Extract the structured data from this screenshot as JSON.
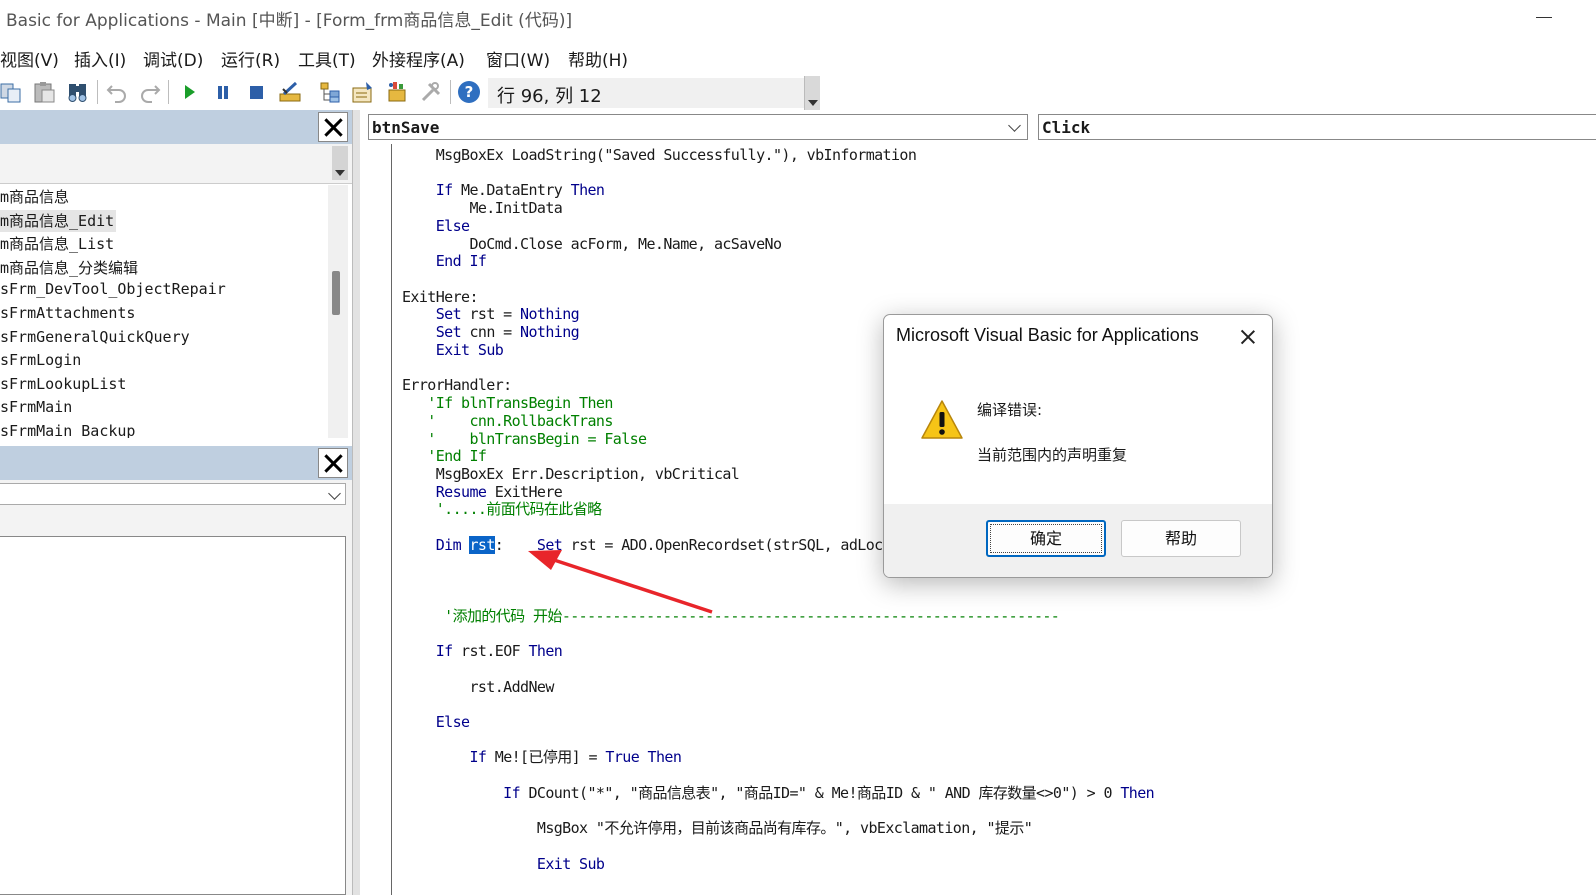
{
  "window": {
    "title": "Basic for Applications - Main [中断] - [Form_frm商品信息_Edit (代码)]"
  },
  "menu": {
    "items": [
      "视图(V)",
      "插入(I)",
      "调试(D)",
      "运行(R)",
      "工具(T)",
      "外接程序(A)",
      "窗口(W)",
      "帮助(H)"
    ]
  },
  "toolbar": {
    "icons": [
      "copy-icon",
      "paste-icon",
      "find-icon",
      "undo-icon",
      "redo-icon",
      "run-icon",
      "break-icon",
      "reset-icon",
      "design-mode-icon",
      "project-explorer-icon",
      "properties-icon",
      "object-browser-icon",
      "toolbox-icon",
      "help-icon"
    ],
    "cursor_position": "行 96, 列 12"
  },
  "project_explorer": {
    "items": [
      "m商品信息",
      "m商品信息_Edit",
      "m商品信息_List",
      "m商品信息_分类编辑",
      "sFrm_DevTool_ObjectRepair",
      "sFrmAttachments",
      "sFrmGeneralQuickQuery",
      "sFrmLogin",
      "sFrmLookupList",
      "sFrmMain",
      "sFrmMain_Backup"
    ],
    "selected_index": 1
  },
  "code_window": {
    "object": "btnSave",
    "procedure": "Click"
  },
  "code_lines": [
    [
      {
        "t": "    MsgBoxEx LoadString(\"Saved Successfully.\"), vbInformation",
        "c": ""
      }
    ],
    [
      {
        "t": "",
        "c": ""
      }
    ],
    [
      {
        "t": "    ",
        "c": ""
      },
      {
        "t": "If",
        "c": "kw"
      },
      {
        "t": " Me.DataEntry ",
        "c": ""
      },
      {
        "t": "Then",
        "c": "kw"
      }
    ],
    [
      {
        "t": "        Me.InitData",
        "c": ""
      }
    ],
    [
      {
        "t": "    ",
        "c": ""
      },
      {
        "t": "Else",
        "c": "kw"
      }
    ],
    [
      {
        "t": "        DoCmd.Close acForm, Me.Name, acSaveNo",
        "c": ""
      }
    ],
    [
      {
        "t": "    ",
        "c": ""
      },
      {
        "t": "End If",
        "c": "kw"
      }
    ],
    [
      {
        "t": "",
        "c": ""
      }
    ],
    [
      {
        "t": "ExitHere:",
        "c": ""
      }
    ],
    [
      {
        "t": "    ",
        "c": ""
      },
      {
        "t": "Set",
        "c": "kw"
      },
      {
        "t": " rst = ",
        "c": ""
      },
      {
        "t": "Nothing",
        "c": "kw"
      }
    ],
    [
      {
        "t": "    ",
        "c": ""
      },
      {
        "t": "Set",
        "c": "kw"
      },
      {
        "t": " cnn = ",
        "c": ""
      },
      {
        "t": "Nothing",
        "c": "kw"
      }
    ],
    [
      {
        "t": "    ",
        "c": ""
      },
      {
        "t": "Exit Sub",
        "c": "kw"
      }
    ],
    [
      {
        "t": "",
        "c": ""
      }
    ],
    [
      {
        "t": "ErrorHandler:",
        "c": ""
      }
    ],
    [
      {
        "t": "   'If blnTransBegin Then",
        "c": "cm"
      }
    ],
    [
      {
        "t": "   '    cnn.RollbackTrans",
        "c": "cm"
      }
    ],
    [
      {
        "t": "   '    blnTransBegin = False",
        "c": "cm"
      }
    ],
    [
      {
        "t": "   'End If",
        "c": "cm"
      }
    ],
    [
      {
        "t": "    MsgBoxEx Err.Description, vbCritical",
        "c": ""
      }
    ],
    [
      {
        "t": "    ",
        "c": ""
      },
      {
        "t": "Resume",
        "c": "kw"
      },
      {
        "t": " ExitHere",
        "c": ""
      }
    ],
    [
      {
        "t": "    '.....前面代码在此省略",
        "c": "cm"
      }
    ],
    [
      {
        "t": "",
        "c": ""
      }
    ],
    [
      {
        "t": "    ",
        "c": ""
      },
      {
        "t": "Dim",
        "c": "kw"
      },
      {
        "t": " ",
        "c": ""
      },
      {
        "t": "rst",
        "c": "sel"
      },
      {
        "t": ":    ",
        "c": ""
      },
      {
        "t": "Set",
        "c": "kw"
      },
      {
        "t": " rst = ADO.OpenRecordset(strSQL, adLockOptimistic)",
        "c": ""
      }
    ],
    [
      {
        "t": "",
        "c": ""
      }
    ],
    [
      {
        "t": "",
        "c": ""
      }
    ],
    [
      {
        "t": "",
        "c": ""
      }
    ],
    [
      {
        "t": "     '添加的代码 开始-----------------------------------------------------------",
        "c": "cm"
      }
    ],
    [
      {
        "t": "",
        "c": ""
      }
    ],
    [
      {
        "t": "    ",
        "c": ""
      },
      {
        "t": "If",
        "c": "kw"
      },
      {
        "t": " rst.EOF ",
        "c": ""
      },
      {
        "t": "Then",
        "c": "kw"
      }
    ],
    [
      {
        "t": "",
        "c": ""
      }
    ],
    [
      {
        "t": "        rst.AddNew",
        "c": ""
      }
    ],
    [
      {
        "t": "",
        "c": ""
      }
    ],
    [
      {
        "t": "    ",
        "c": ""
      },
      {
        "t": "Else",
        "c": "kw"
      }
    ],
    [
      {
        "t": "",
        "c": ""
      }
    ],
    [
      {
        "t": "        ",
        "c": ""
      },
      {
        "t": "If",
        "c": "kw"
      },
      {
        "t": " Me![已停用] = ",
        "c": ""
      },
      {
        "t": "True Then",
        "c": "kw"
      }
    ],
    [
      {
        "t": "",
        "c": ""
      }
    ],
    [
      {
        "t": "            ",
        "c": ""
      },
      {
        "t": "If",
        "c": "kw"
      },
      {
        "t": " DCount(\"*\", \"商品信息表\", \"商品ID=\" & Me!商品ID & \" AND 库存数量<>0\") > 0 ",
        "c": ""
      },
      {
        "t": "Then",
        "c": "kw"
      }
    ],
    [
      {
        "t": "",
        "c": ""
      }
    ],
    [
      {
        "t": "                MsgBox \"不允许停用，目前该商品尚有库存。\", vbExclamation, \"提示\"",
        "c": ""
      }
    ],
    [
      {
        "t": "",
        "c": ""
      }
    ],
    [
      {
        "t": "                ",
        "c": ""
      },
      {
        "t": "Exit Sub",
        "c": "kw"
      }
    ]
  ],
  "dialog": {
    "title": "Microsoft Visual Basic for Applications",
    "error_title": "编译错误:",
    "error_message": "当前范围内的声明重复",
    "ok_label": "确定",
    "help_label": "帮助",
    "icon": "warning-icon"
  },
  "colors": {
    "keyword": "#00008b",
    "comment": "#008000",
    "selection": "#0a64c8",
    "annotation_arrow": "#e8252a",
    "panel_header": "#bfcfe0",
    "dialog_default_button_border": "#0067c0"
  }
}
